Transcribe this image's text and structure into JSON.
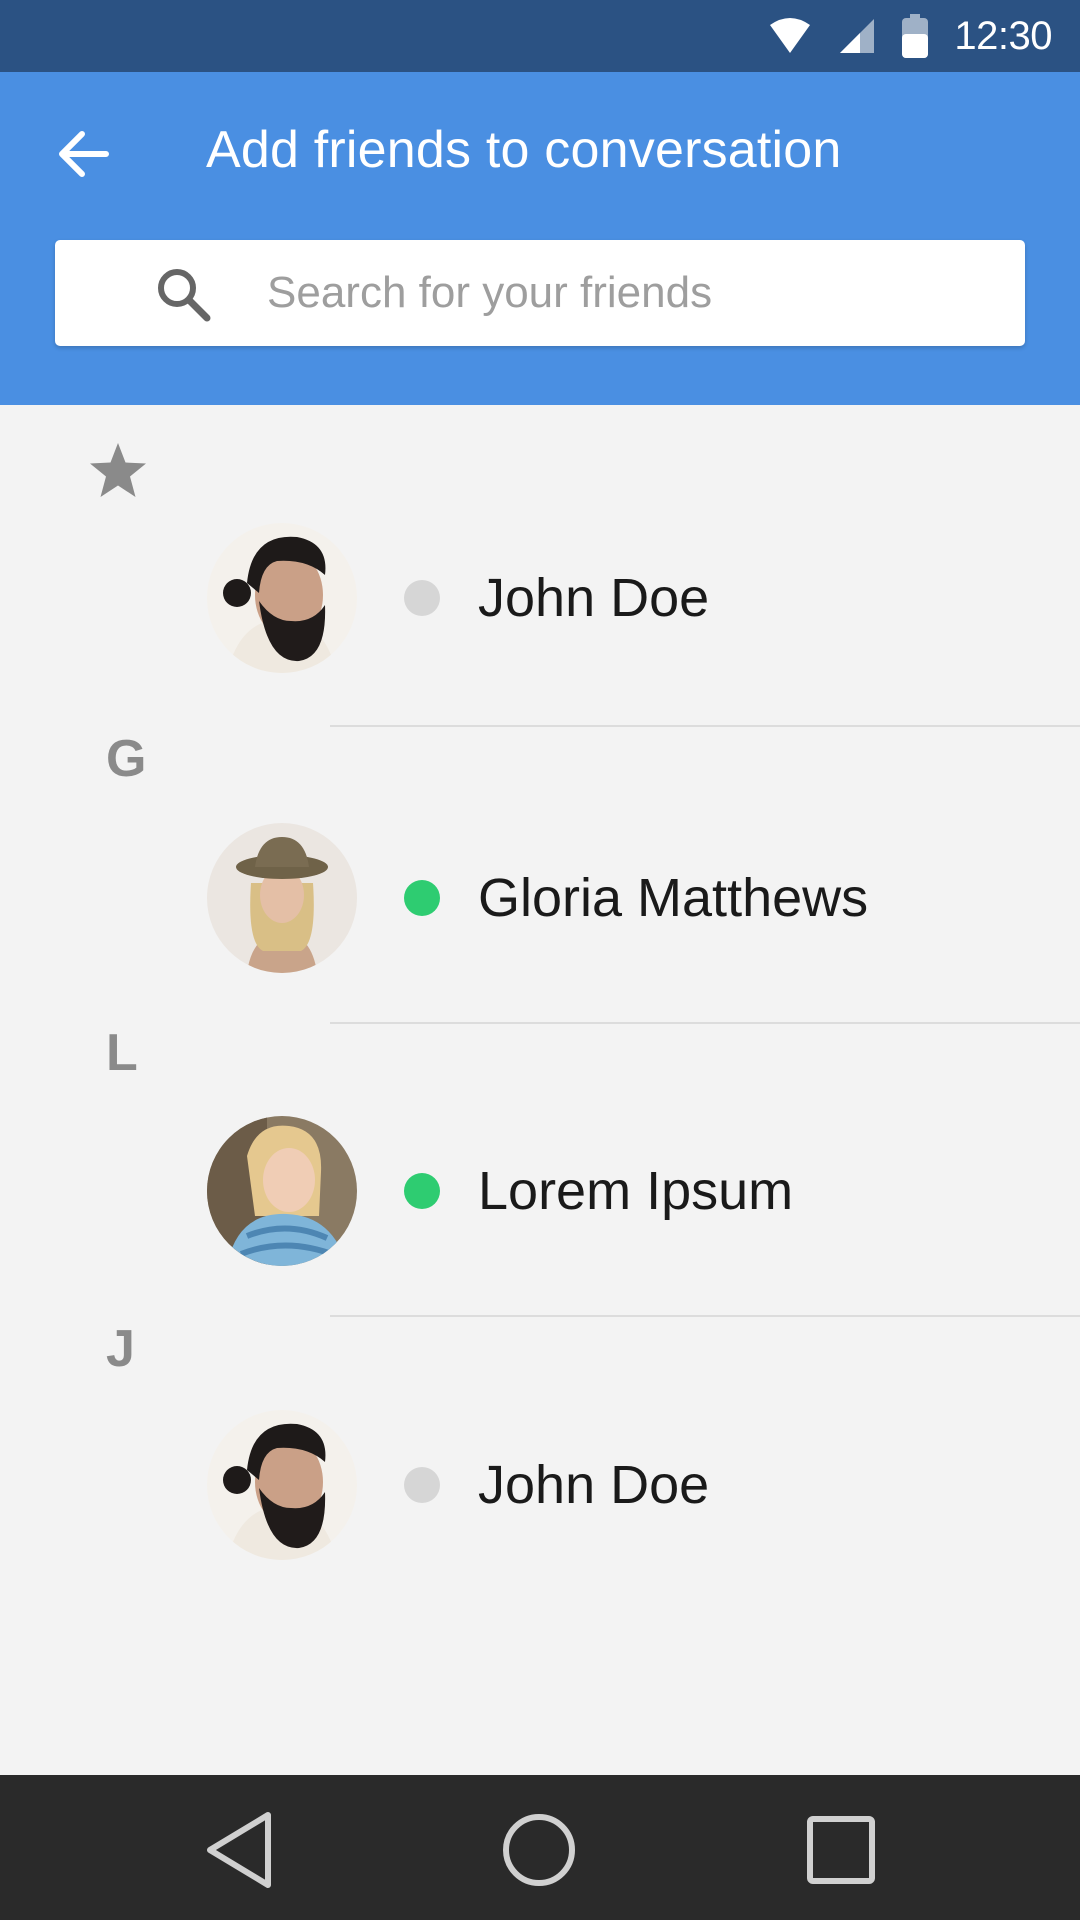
{
  "status_bar": {
    "time": "12:30",
    "icons": [
      "wifi-icon",
      "cell-signal-icon",
      "battery-icon"
    ]
  },
  "app_bar": {
    "back_icon": "arrow-back-icon",
    "title": "Add friends to conversation",
    "search": {
      "icon": "search-icon",
      "placeholder": "Search for your friends",
      "value": ""
    }
  },
  "sections": [
    {
      "label": "",
      "icon": "star-icon",
      "friends": [
        {
          "name": "John Doe",
          "status": "offline",
          "avatar": "bearded-man"
        }
      ]
    },
    {
      "label": "G",
      "friends": [
        {
          "name": "Gloria Matthews",
          "status": "online",
          "avatar": "woman-hat"
        }
      ]
    },
    {
      "label": "L",
      "friends": [
        {
          "name": "Lorem Ipsum",
          "status": "online",
          "avatar": "woman-scarf"
        }
      ]
    },
    {
      "label": "J",
      "friends": [
        {
          "name": "John Doe",
          "status": "offline",
          "avatar": "bearded-man"
        }
      ]
    }
  ],
  "colors": {
    "status_bar": "#2b5283",
    "app_bar": "#4a8fe2",
    "online": "#2ecc71",
    "offline": "#d6d6d6",
    "background": "#f3f3f3",
    "nav_bar": "#2a2a2a"
  },
  "nav_bar": {
    "icons": [
      "back-triangle-icon",
      "home-circle-icon",
      "recents-square-icon"
    ]
  }
}
